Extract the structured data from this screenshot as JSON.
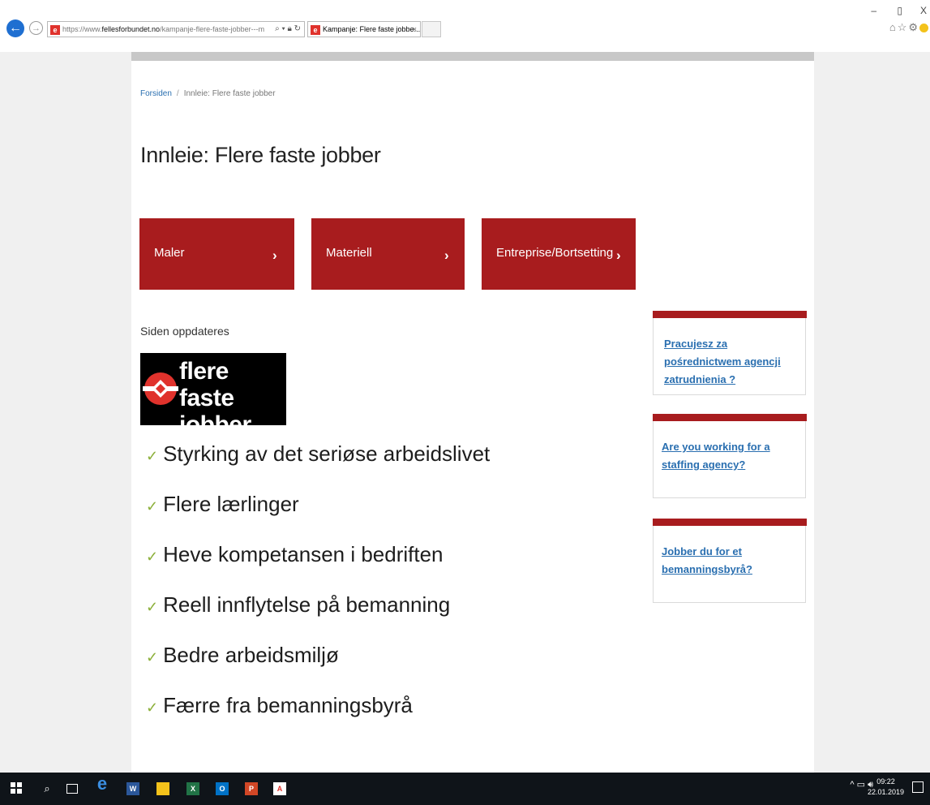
{
  "browser": {
    "url_prefix": "https://www.",
    "url_domain": "fellesforbundet.no",
    "url_path": "/kampanje-flere-faste-jobber---m",
    "tab_title": "Kampanje: Flere faste jobbe...",
    "tab_close": "×",
    "window_controls": {
      "minimize": "–",
      "restore": "▯",
      "close": "X"
    }
  },
  "breadcrumb": {
    "home": "Forsiden",
    "separator": "/",
    "current": "Innleie: Flere faste jobber"
  },
  "page_title": "Innleie: Flere faste jobber",
  "categories": [
    {
      "label": "Maler",
      "chevron": "›"
    },
    {
      "label": "Materiell",
      "chevron": "›"
    },
    {
      "label": "Entreprise/Bortsetting",
      "chevron": "›"
    }
  ],
  "status_text": "Siden oppdateres",
  "logo": {
    "line1": "flere faste",
    "line2": "jobber"
  },
  "checklist": [
    "Styrking av det seriøse arbeidslivet",
    "Flere lærlinger",
    "Heve kompetansen i bedriften",
    "Reell innflytelse på bemanning",
    "Bedre arbeidsmiljø",
    "Færre fra bemanningsbyrå"
  ],
  "check_mark": "✓",
  "sidebar_links": [
    "Pracujesz za pośrednictwem agencji zatrudnienia ?",
    "Are you working for a staffing agency?",
    "Jobber du for et bemanningsbyrå?"
  ],
  "taskbar": {
    "time": "09:22",
    "date": "22.01.2019",
    "apps": [
      "start",
      "search",
      "task-view",
      "edge",
      "word",
      "file-explorer",
      "excel",
      "outlook",
      "powerpoint",
      "acrobat"
    ]
  },
  "colors": {
    "brand_red": "#a81c1e",
    "link_blue": "#2a6fb0",
    "check_green": "#8cb03a"
  }
}
